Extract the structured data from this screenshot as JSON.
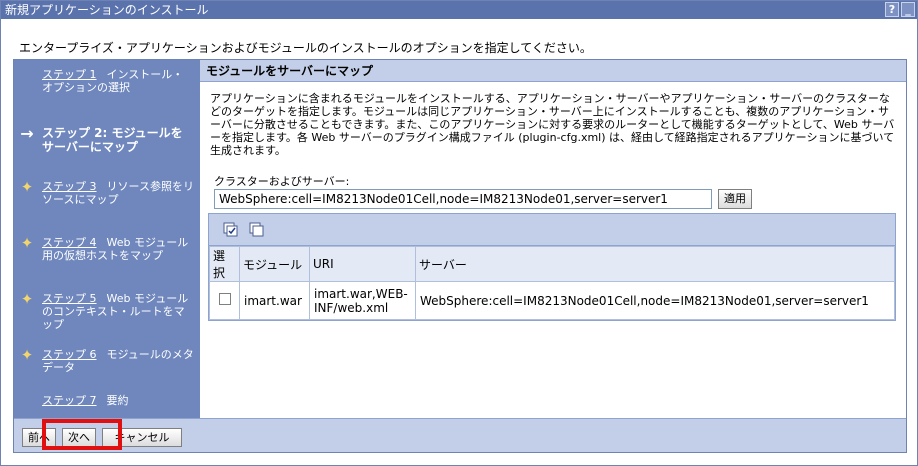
{
  "window": {
    "title": "新規アプリケーションのインストール",
    "help_button": "?",
    "minimize_button": "_"
  },
  "instruction": "エンタープライズ・アプリケーションおよびモジュールのインストールのオプションを指定してください。",
  "sidebar": {
    "steps": [
      {
        "link": "ステップ 1",
        "text": "インストール・オプションの選択",
        "marker": "",
        "current": false
      },
      {
        "link": "",
        "text": "ステップ 2: モジュールをサーバーにマップ",
        "marker": "→",
        "current": true
      },
      {
        "link": "ステップ 3",
        "text": "リソース参照をリソースにマップ",
        "marker": "✦",
        "current": false
      },
      {
        "link": "ステップ 4",
        "text": "Web モジュール用の仮想ホストをマップ",
        "marker": "✦",
        "current": false
      },
      {
        "link": "ステップ 5",
        "text": "Web モジュールのコンテキスト・ルートをマップ",
        "marker": "✦",
        "current": false
      },
      {
        "link": "ステップ 6",
        "text": "モジュールのメタデータ",
        "marker": "✦",
        "current": false
      },
      {
        "link": "ステップ 7",
        "text": "要約",
        "marker": "",
        "current": false
      }
    ]
  },
  "main": {
    "header": "モジュールをサーバーにマップ",
    "description": "アプリケーションに含まれるモジュールをインストールする、アプリケーション・サーバーやアプリケーション・サーバーのクラスターなどのターゲットを指定します。モジュールは同じアプリケーション・サーバー上にインストールすることも、複数のアプリケーション・サーバーに分散させることもできます。また、このアプリケーションに対する要求のルーターとして機能するターゲットとして、Web サーバーを指定します。各 Web サーバーのプラグイン構成ファイル (plugin-cfg.xml) は、経由して経路指定されるアプリケーションに基づいて生成されます。",
    "cluster_label": "クラスターおよびサーバー:",
    "cluster_value": "WebSphere:cell=IM8213Node01Cell,node=IM8213Node01,server=server1",
    "apply_label": "適用",
    "toolbar_icons": [
      "select-all-icon",
      "deselect-all-icon"
    ],
    "table": {
      "headers": [
        "選択",
        "モジュール",
        "URI",
        "サーバー"
      ],
      "rows": [
        {
          "module": "imart.war",
          "uri": "imart.war,WEB-INF/web.xml",
          "server": "WebSphere:cell=IM8213Node01Cell,node=IM8213Node01,server=server1"
        }
      ]
    }
  },
  "footer": {
    "previous_label": "前へ",
    "next_label": "次へ",
    "cancel_label": "キャンセル"
  },
  "colors": {
    "titlebar": "#5b73ad",
    "sidebar": "#6f87bd",
    "header_bar": "#c3cfe8",
    "highlight": "#e01010"
  }
}
